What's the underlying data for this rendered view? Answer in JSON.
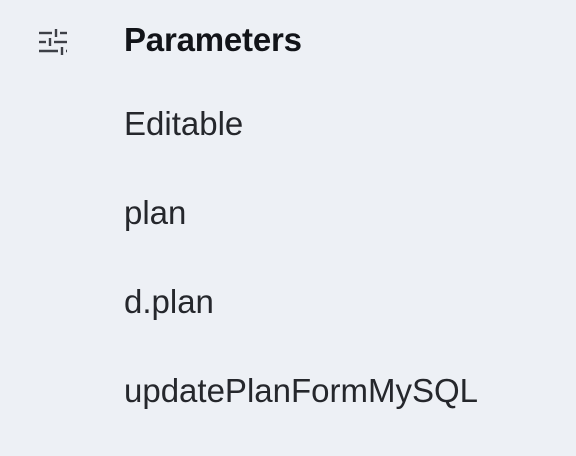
{
  "section": {
    "icon": "sliders-icon",
    "title": "Parameters"
  },
  "items": [
    {
      "label": "Editable"
    },
    {
      "label": "plan"
    },
    {
      "label": "d.plan"
    },
    {
      "label": "updatePlanFormMySQL"
    }
  ],
  "colors": {
    "background": "#edf0f5",
    "title": "#121419",
    "text": "#25272c",
    "icon": "#3d4047"
  }
}
